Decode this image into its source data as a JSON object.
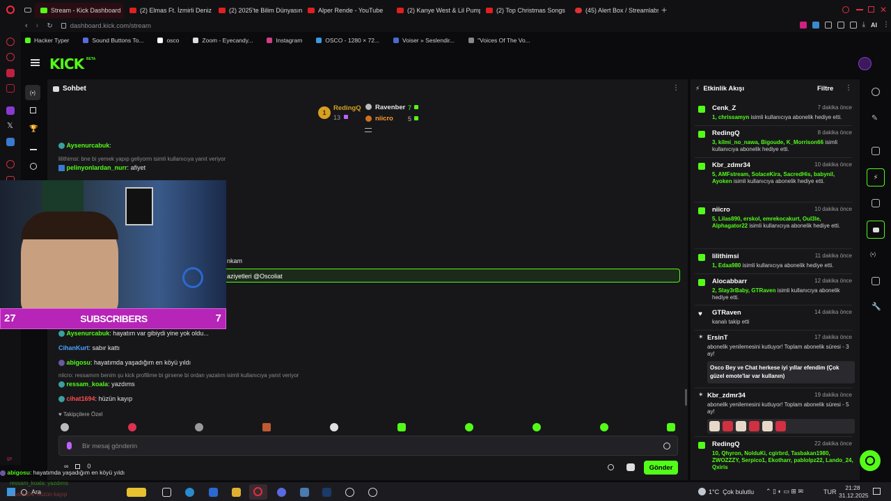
{
  "browser": {
    "tabs": [
      {
        "label": "Stream - Kick Dashboard",
        "fav": "k",
        "active": true
      },
      {
        "label": "(2) Elmas Ft. İzmirli Deniz",
        "fav": "y",
        "active": false
      },
      {
        "label": "(2) 2025'te Bilim Dünyasın",
        "fav": "y",
        "active": false
      },
      {
        "label": "Alper Rende - YouTube",
        "fav": "y",
        "active": false
      },
      {
        "label": "(2) Kanye West & Lil Pump",
        "fav": "y",
        "active": false
      },
      {
        "label": "(2) Top Christmas Songs",
        "fav": "y",
        "active": false
      },
      {
        "label": "(45) Alert Box / Streamlabs",
        "fav": "p",
        "active": false
      }
    ],
    "url_host": "dashboard.kick.com",
    "url_path": "/stream",
    "ai_label": "AI",
    "bookmarks": [
      "Hacker Typer",
      "Sound Buttons To...",
      "osco",
      "Zoom - Eyecandy...",
      "Instagram",
      "OSCO - 1280 × 72...",
      "Voiser » Seslendir...",
      "\"Voices Of The Vo..."
    ]
  },
  "kick": {
    "logo": "KICK",
    "logo_badge": "BETA"
  },
  "chat": {
    "title": "Sohbet",
    "top_gifters": [
      {
        "rank": "1",
        "name": "RedingQ",
        "count": "13"
      },
      {
        "name": "Ravenber",
        "count": "7"
      },
      {
        "name": "niicro",
        "count": "5"
      }
    ],
    "messages": [
      {
        "user": "Aysenurcabuk",
        "text": "",
        "color": "#53fc18"
      },
      {
        "reply": "lilithimsi: bne bi yemek yapıp geliyorm isimli kullanıcıya yanıt veriyor"
      },
      {
        "user": "pelinyonlardan_nurr",
        "text": "afiyet",
        "color": "#53fc18"
      },
      {
        "partial": "nkam"
      },
      {
        "partial": "aziyetleri @Oscoliat"
      },
      {
        "user": "Aysenurcabuk",
        "text": "hayatım var gibiydi yine yok oldu...",
        "color": "#53fc18"
      },
      {
        "user": "CihanKurt",
        "text": "sabır kattı",
        "color": "#4aa3ff"
      },
      {
        "user": "abigosu",
        "text": "hayatımda yaşadığım en köyü yıldı",
        "color": "#53fc18"
      },
      {
        "reply": "niicro: ressamım benim şu kick profilime bi girsene bi ordan yazalım isimli kullanıcıya yanıt veriyor"
      },
      {
        "user": "ressam_koala",
        "text": "yazdıms",
        "color": "#53fc18"
      },
      {
        "user": "cihat1694",
        "text": "hüzün kayıp",
        "color": "#ff4d4d"
      }
    ],
    "followers_only": "Takipçilere Özel",
    "input_placeholder": "Bir mesaj gönderin",
    "viewer_count": "0",
    "send_label": "Gönder"
  },
  "overlay": {
    "sub_left": "27",
    "sub_label": "SUBSCRIBERS",
    "sub_right": "7"
  },
  "feed": {
    "title": "Etkinlik Akışı",
    "filter_label": "Filtre",
    "entries": [
      {
        "user": "Cenk_Z",
        "time": "7 dakika önce",
        "hl": "1, chrissamyn",
        "text": " isimli kullanıcıya abonelik hediye etti."
      },
      {
        "user": "RedingQ",
        "time": "8 dakika önce",
        "hl": "3, kilmi_no_nawa, Bigoude, K_Morrison66",
        "text": " isimli kullanıcıya abonelik hediye etti."
      },
      {
        "user": "Kbr_zdmr34",
        "time": "10 dakika önce",
        "hl": "5, AMFstream, SolaceKira, SacredHis, babynil, Ayoken",
        "text": " isimli kullanıcıya abonelik hediye etti."
      },
      {
        "user": "niicro",
        "time": "10 dakika önce",
        "hl": "5, Lilas890, erskol, emrekocakurt, Oul3le, Alphagator22",
        "text": " isimli kullanıcıya abonelik hediye etti."
      },
      {
        "user": "lilithimsi",
        "time": "11 dakika önce",
        "hl": "1, Edaa980",
        "text": " isimli kullanıcıya abonelik hediye etti."
      },
      {
        "user": "Alocabbarr",
        "time": "12 dakika önce",
        "hl": "2, Slay3rBaby, GTRaven",
        "text": " isimli kullanıcıya abonelik hediye etti."
      },
      {
        "user": "GTRaven",
        "time": "14 dakika önce",
        "hl": "",
        "text": "kanalı takip etti"
      },
      {
        "user": "ErsinT",
        "time": "17 dakika önce",
        "hl": "",
        "text": "abonelik yenilemesini kutluyor! Toplam abonelik süresi - 3 ay!",
        "quote": "Osco Bey ve Chat herkese iyi yıllar efendim (Çok güzel emote'lar var kullanın)"
      },
      {
        "user": "Kbr_zdmr34",
        "time": "19 dakika önce",
        "hl": "",
        "text": "abonelik yenilemesini kutluyor! Toplam abonelik süresi - 5 ay!"
      },
      {
        "user": "RedingQ",
        "time": "22 dakika önce",
        "hl": "10, Qhyron, NolduKi, cgirbrd, Tasbakan1980, ZWOZZZY, Serpico1, Ekotharr, pablolpz22, Lando_24, Qxiris",
        "text": ""
      }
    ]
  },
  "taskbar": {
    "search": "Ara",
    "weather": "1°C  Çok bulutlu",
    "lang": "TUR",
    "time": "21:28",
    "date": "31.12.2025",
    "popup_user": "abigosu",
    "popup_text": "hayatımda yaşadığım en köyü yıldı",
    "ghost1": "ressam_koala: yazdıms",
    "ghost2": "cihat1694: hüzün kayıp"
  }
}
